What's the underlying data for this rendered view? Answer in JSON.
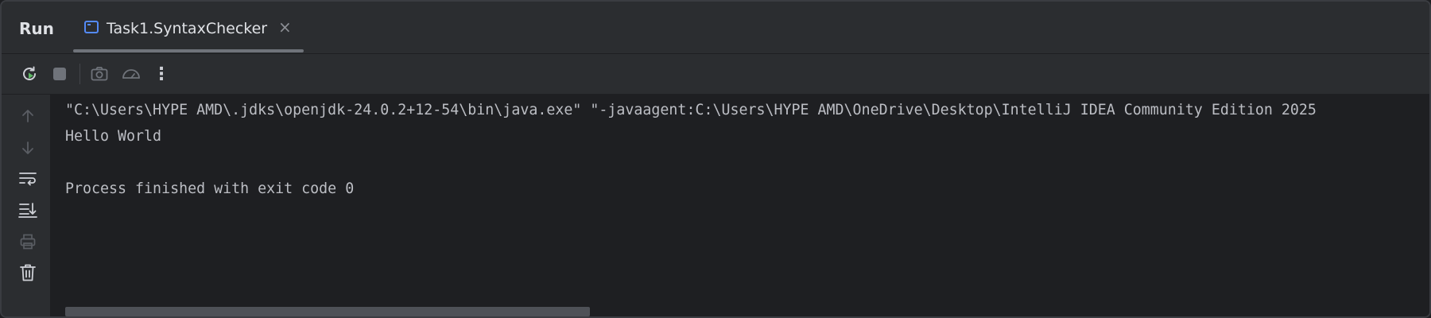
{
  "header": {
    "title": "Run",
    "tab": {
      "label": "Task1.SyntaxChecker",
      "close_glyph": "×"
    }
  },
  "toolbar": {
    "icons": [
      "rerun-icon",
      "stop-icon",
      "camera-icon",
      "profiler-icon",
      "more-icon"
    ],
    "more_glyph": "⋮"
  },
  "sidebar": {
    "icons": [
      "arrow-up-icon",
      "arrow-down-icon",
      "soft-wrap-icon",
      "scroll-to-end-icon",
      "print-icon",
      "trash-icon"
    ]
  },
  "console": {
    "lines": [
      "\"C:\\Users\\HYPE AMD\\.jdks\\openjdk-24.0.2+12-54\\bin\\java.exe\" \"-javaagent:C:\\Users\\HYPE AMD\\OneDrive\\Desktop\\IntelliJ IDEA Community Edition 2025",
      "Hello World",
      "",
      "Process finished with exit code 0"
    ]
  },
  "colors": {
    "background": "#1e1f22",
    "panel": "#2b2d30",
    "text": "#bcbec4",
    "accent_green": "#5fb865",
    "accent_blue": "#548af7"
  }
}
